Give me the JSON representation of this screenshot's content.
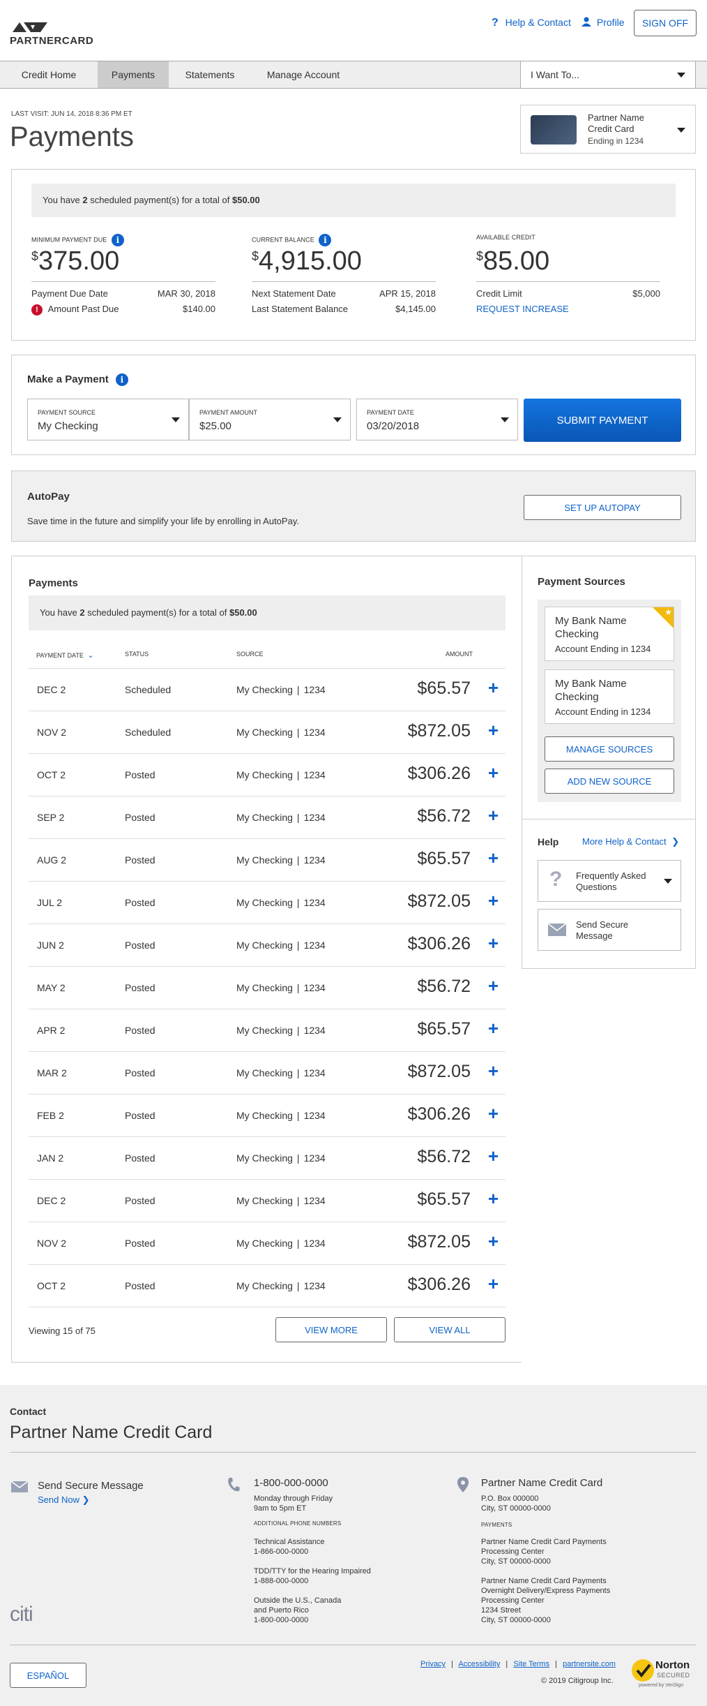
{
  "header": {
    "brand": "PARTNERCARD",
    "help_label": "Help & Contact",
    "profile_label": "Profile",
    "signoff_label": "SIGN OFF"
  },
  "nav": {
    "items": [
      {
        "label": "Credit Home",
        "active": false
      },
      {
        "label": "Payments",
        "active": true
      },
      {
        "label": "Statements",
        "active": false
      },
      {
        "label": "Manage Account",
        "active": false
      }
    ],
    "iwant_label": "I Want To..."
  },
  "page": {
    "last_visit": "LAST VISIT: JUN 14, 2018 8:36 PM ET",
    "title": "Payments"
  },
  "card_selector": {
    "name": "Partner Name Credit Card",
    "ending": "Ending in 1234"
  },
  "summary": {
    "banner_pre": "You have ",
    "banner_count": "2",
    "banner_mid": " scheduled payment(s) for a total of ",
    "banner_total": "$50.00",
    "min_payment_label": "MINIMUM PAYMENT DUE",
    "min_payment_currency": "$",
    "min_payment_value": "375.00",
    "due_date_label": "Payment Due Date",
    "due_date_value": "MAR 30, 2018",
    "past_due_label": "Amount Past Due",
    "past_due_value": "$140.00",
    "balance_label": "CURRENT BALANCE",
    "balance_currency": "$",
    "balance_value": "4,915.00",
    "next_statement_label": "Next Statement Date",
    "next_statement_value": "APR 15, 2018",
    "last_statement_label": "Last Statement Balance",
    "last_statement_value": "$4,145.00",
    "available_label": "AVAILABLE CREDIT",
    "available_currency": "$",
    "available_value": "85.00",
    "credit_limit_label": "Credit Limit",
    "credit_limit_value": "$5,000",
    "request_increase_label": "REQUEST INCREASE"
  },
  "make_payment": {
    "title": "Make a Payment",
    "source_label": "PAYMENT SOURCE",
    "source_value": "My Checking",
    "amount_label": "PAYMENT AMOUNT",
    "amount_value": "$25.00",
    "date_label": "PAYMENT DATE",
    "date_value": "03/20/2018",
    "submit_label": "SUBMIT PAYMENT"
  },
  "autopay": {
    "title": "AutoPay",
    "description": "Save time in the future and simplify your life by enrolling in AutoPay.",
    "button_label": "SET UP AUTOPAY"
  },
  "payments": {
    "title": "Payments",
    "banner_pre": "You have ",
    "banner_count": "2",
    "banner_mid": " scheduled payment(s) for a total of ",
    "banner_total": "$50.00",
    "columns": {
      "date": "PAYMENT DATE",
      "status": "STATUS",
      "source": "SOURCE",
      "amount": "AMOUNT"
    },
    "rows": [
      {
        "date": "DEC 2",
        "status": "Scheduled",
        "source": "My Checking",
        "acct": "1234",
        "amount": "$65.57"
      },
      {
        "date": "NOV 2",
        "status": "Scheduled",
        "source": "My Checking",
        "acct": "1234",
        "amount": "$872.05"
      },
      {
        "date": "OCT 2",
        "status": "Posted",
        "source": "My Checking",
        "acct": "1234",
        "amount": "$306.26"
      },
      {
        "date": "SEP 2",
        "status": "Posted",
        "source": "My Checking",
        "acct": "1234",
        "amount": "$56.72"
      },
      {
        "date": "AUG 2",
        "status": "Posted",
        "source": "My Checking",
        "acct": "1234",
        "amount": "$65.57"
      },
      {
        "date": "JUL 2",
        "status": "Posted",
        "source": "My Checking",
        "acct": "1234",
        "amount": "$872.05"
      },
      {
        "date": "JUN 2",
        "status": "Posted",
        "source": "My Checking",
        "acct": "1234",
        "amount": "$306.26"
      },
      {
        "date": "MAY 2",
        "status": "Posted",
        "source": "My Checking",
        "acct": "1234",
        "amount": "$56.72"
      },
      {
        "date": "APR 2",
        "status": "Posted",
        "source": "My Checking",
        "acct": "1234",
        "amount": "$65.57"
      },
      {
        "date": "MAR 2",
        "status": "Posted",
        "source": "My Checking",
        "acct": "1234",
        "amount": "$872.05"
      },
      {
        "date": "FEB 2",
        "status": "Posted",
        "source": "My Checking",
        "acct": "1234",
        "amount": "$306.26"
      },
      {
        "date": "JAN 2",
        "status": "Posted",
        "source": "My Checking",
        "acct": "1234",
        "amount": "$56.72"
      },
      {
        "date": "DEC 2",
        "status": "Posted",
        "source": "My Checking",
        "acct": "1234",
        "amount": "$65.57"
      },
      {
        "date": "NOV 2",
        "status": "Posted",
        "source": "My Checking",
        "acct": "1234",
        "amount": "$872.05"
      },
      {
        "date": "OCT 2",
        "status": "Posted",
        "source": "My Checking",
        "acct": "1234",
        "amount": "$306.26"
      }
    ],
    "viewing": "Viewing 15 of 75",
    "view_more_label": "VIEW MORE",
    "view_all_label": "VIEW ALL"
  },
  "sources": {
    "title": "Payment Sources",
    "items": [
      {
        "name": "My Bank Name Checking",
        "ending": "Account Ending in 1234"
      },
      {
        "name": "My Bank Name Checking",
        "ending": "Account Ending in 1234"
      }
    ],
    "manage_label": "MANAGE SOURCES",
    "add_label": "ADD NEW SOURCE"
  },
  "help": {
    "title": "Help",
    "more_label": "More Help & Contact",
    "faq_label": "Frequently Asked Questions",
    "message_label": "Send Secure Message"
  },
  "footer": {
    "contact_label": "Contact",
    "card_name": "Partner Name Credit Card",
    "send_message_title": "Send Secure Message",
    "send_now_label": "Send Now",
    "phone_main": "1-800-000-0000",
    "phone_hours_1": "Monday through Friday",
    "phone_hours_2": "9am to 5pm ET",
    "additional_label": "ADDITIONAL PHONE NUMBERS",
    "tech_label": "Technical Assistance",
    "tech_phone": "1-866-000-0000",
    "tdd_label": "TDD/TTY for the Hearing Impaired",
    "tdd_phone": "1-888-000-0000",
    "outside_label_1": "Outside the U.S., Canada",
    "outside_label_2": "and Puerto Rico",
    "outside_phone": "1-800-000-0000",
    "address_title": "Partner Name Credit Card",
    "address_1": "P.O. Box 000000",
    "address_2": "City, ST 00000-0000",
    "payments_label": "PAYMENTS",
    "pay_addr_1": "Partner Name Credit Card Payments",
    "pay_addr_2": "Processing Center",
    "pay_addr_3": "City, ST 00000-0000",
    "over_addr_1": "Partner Name Credit Card Payments",
    "over_addr_2": "Overnight Delivery/Express Payments",
    "over_addr_3": "Processing Center",
    "over_addr_4": "1234 Street",
    "over_addr_5": "City, ST 00000-0000",
    "citi_logo": "citi",
    "espanol_label": "ESPAÑOL",
    "links": [
      "Privacy",
      "Accessibility",
      "Site Terms",
      "partnersite.com"
    ],
    "copyright": "© 2019 Citigroup Inc.",
    "norton_1": "Norton",
    "norton_2": "SECURED",
    "norton_3": "powered by VeriSign"
  },
  "colors": {
    "accent": "#0f62c9",
    "warning": "#c8102e",
    "star": "#f2b90f"
  }
}
